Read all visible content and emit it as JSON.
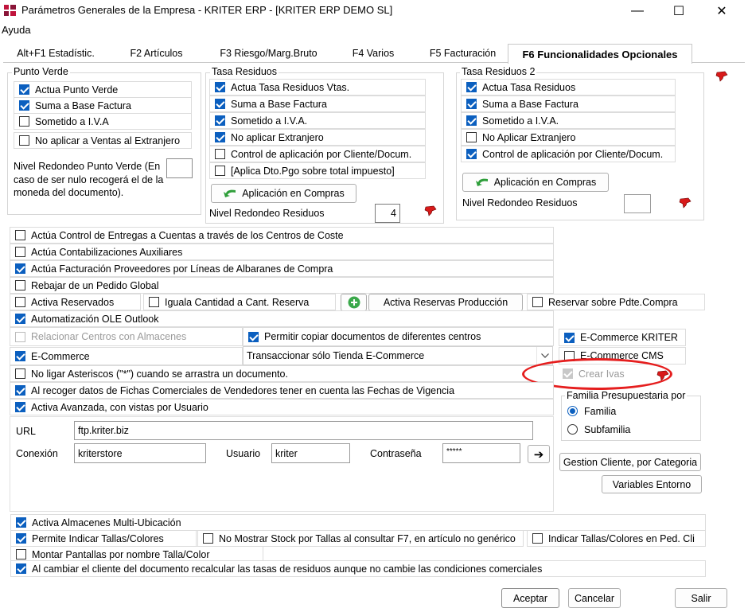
{
  "window": {
    "title": "Parámetros Generales de la Empresa - KRITER ERP - [KRITER ERP DEMO SL]",
    "minimize": "—",
    "maximize": "☐",
    "close": "✕"
  },
  "menu": {
    "help": "Ayuda"
  },
  "tabs": [
    {
      "label": "Alt+F1 Estadístic."
    },
    {
      "label": "F2 Artículos"
    },
    {
      "label": "F3 Riesgo/Marg.Bruto"
    },
    {
      "label": "F4 Varios"
    },
    {
      "label": "F5 Facturación"
    },
    {
      "label": "F6 Funcionalidades Opcionales"
    }
  ],
  "punto_verde": {
    "title": "Punto Verde",
    "items": [
      {
        "label": "Actua Punto Verde",
        "checked": true
      },
      {
        "label": "Suma a Base Factura",
        "checked": true
      },
      {
        "label": "Sometido a I.V.A",
        "checked": false
      },
      {
        "label": "No aplicar a Ventas al Extranjero",
        "checked": false
      }
    ],
    "nivel_label": "Nivel Redondeo Punto Verde (En caso de ser nulo recogerá el de la moneda del documento).",
    "nivel_value": ""
  },
  "tasa_residuos": {
    "title": "Tasa Residuos",
    "items": [
      {
        "label": "Actua Tasa Residuos Vtas.",
        "checked": true
      },
      {
        "label": "Suma a Base Factura",
        "checked": true
      },
      {
        "label": "Sometido a I.V.A.",
        "checked": true
      },
      {
        "label": "No aplicar Extranjero",
        "checked": true
      },
      {
        "label": "Control de aplicación por Cliente/Docum.",
        "checked": false
      },
      {
        "label": "[Aplica Dto.Pgo sobre total impuesto]",
        "checked": false
      }
    ],
    "compras_button": "Aplicación en Compras",
    "nivel_label": "Nivel Redondeo Residuos",
    "nivel_value": "4"
  },
  "tasa_residuos2": {
    "title": "Tasa Residuos 2",
    "items": [
      {
        "label": "Actua Tasa Residuos",
        "checked": true
      },
      {
        "label": "Suma a Base Factura",
        "checked": true
      },
      {
        "label": "Sometido a I.V.A.",
        "checked": true
      },
      {
        "label": "No Aplicar Extranjero",
        "checked": false
      },
      {
        "label": "Control de aplicación por Cliente/Docum.",
        "checked": true
      }
    ],
    "compras_button": "Aplicación en Compras",
    "nivel_label": "Nivel Redondeo Residuos",
    "nivel_value": ""
  },
  "options": {
    "control_entregas": {
      "label": "Actúa Control de Entregas a Cuentas a través de los Centros de Coste",
      "checked": false
    },
    "contabilizaciones": {
      "label": "Actúa Contabilizaciones Auxiliares",
      "checked": false
    },
    "facturacion_proveedores": {
      "label": "Actúa Facturación Proveedores por Líneas de Albaranes de Compra",
      "checked": true
    },
    "rebajar_pedido": {
      "label": "Rebajar de un Pedido Global",
      "checked": false
    },
    "activa_reservados": {
      "label": "Activa Reservados",
      "checked": false
    },
    "iguala_cantidad": {
      "label": "Iguala Cantidad a Cant. Reserva",
      "checked": false
    },
    "reservas_produccion_button": "Activa Reservas Producción",
    "reservar_pdte": {
      "label": "Reservar sobre Pdte.Compra",
      "checked": false
    },
    "ole_outlook": {
      "label": "Automatización OLE Outlook",
      "checked": true
    },
    "relacionar_centros": {
      "label": "Relacionar Centros con Almacenes",
      "checked": false
    },
    "permitir_copiar": {
      "label": "Permitir copiar documentos de diferentes centros",
      "checked": true
    },
    "ecommerce_kriter": {
      "label": "E-Commerce KRITER",
      "checked": true
    },
    "ecommerce": {
      "label": "E-Commerce",
      "checked": true
    },
    "transaccionar": "Transaccionar sólo Tienda E-Commerce",
    "ecommerce_cms": {
      "label": "E-Commerce CMS",
      "checked": false
    },
    "no_ligar": {
      "label": "No ligar Asteriscos (\"*\") cuando se arrastra un documento.",
      "checked": false
    },
    "crear_ivas": {
      "label": "Crear Ivas",
      "checked": true
    },
    "fichas_comerciales": {
      "label": "Al recoger datos de Fichas Comerciales de Vendedores tener en cuenta las Fechas de Vigencia",
      "checked": true
    },
    "activa_avanzada": {
      "label": "Activa Avanzada, con vistas por Usuario",
      "checked": true
    }
  },
  "familia": {
    "title": "Familia Presupuestaria por",
    "options": [
      {
        "label": "Familia",
        "selected": true
      },
      {
        "label": "Subfamilia",
        "selected": false
      }
    ]
  },
  "connection": {
    "url_label": "URL",
    "url_value": "ftp.kriter.biz",
    "conexion_label": "Conexión",
    "conexion_value": "kriterstore",
    "usuario_label": "Usuario",
    "usuario_value": "kriter",
    "password_label": "Contraseña",
    "password_value": "*****",
    "go_button": "➔"
  },
  "buttons": {
    "gestion_cliente": "Gestion Cliente, por Categoria",
    "variables_entorno": "Variables Entorno",
    "aceptar": "Aceptar",
    "cancelar": "Cancelar",
    "salir": "Salir"
  },
  "bottom_options": {
    "almacenes_multi": {
      "label": "Activa Almacenes Multi-Ubicación",
      "checked": true
    },
    "tallas_colores": {
      "label": "Permite Indicar Tallas/Colores",
      "checked": true
    },
    "no_mostrar_stock": {
      "label": "No Mostrar Stock por Tallas al consultar F7, en artículo no genérico",
      "checked": false
    },
    "indicar_tallas_ped": {
      "label": "Indicar Tallas/Colores en Ped. Cli",
      "checked": false
    },
    "montar_pantallas": {
      "label": "Montar Pantallas por nombre Talla/Color",
      "checked": false
    },
    "recalcular_tasas": {
      "label": "Al cambiar el cliente del documento recalcular las tasas de residuos aunque no cambie las condiciones comerciales",
      "checked": true
    }
  },
  "colors": {
    "accent": "#0b5fbf",
    "highlight": "#e51e1e"
  }
}
